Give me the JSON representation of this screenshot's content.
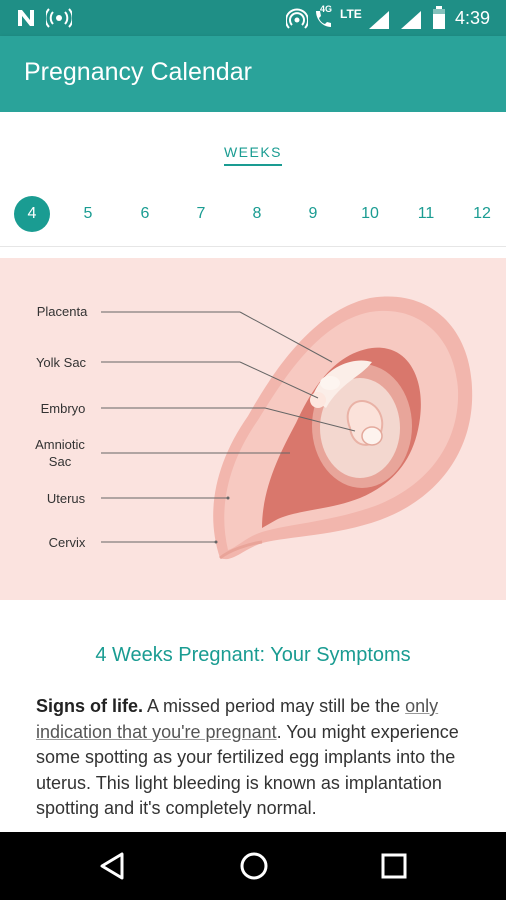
{
  "status_bar": {
    "time": "4:39",
    "network": "LTE",
    "data_type": "4G"
  },
  "app_bar": {
    "title": "Pregnancy Calendar"
  },
  "weeks_tab": {
    "label": "WEEKS"
  },
  "weeks": [
    "4",
    "5",
    "6",
    "7",
    "8",
    "9",
    "10",
    "11",
    "12"
  ],
  "selected_week": "4",
  "illustration": {
    "labels": {
      "placenta": "Placenta",
      "yolk_sac": "Yolk Sac",
      "embryo": "Embryo",
      "amniotic_1": "Amniotic",
      "amniotic_2": "Sac",
      "uterus": "Uterus",
      "cervix": "Cervix"
    }
  },
  "article": {
    "heading": "4 Weeks Pregnant: Your Symptoms",
    "lead": "Signs of life.",
    "text1": " A missed period may still be the ",
    "link": "only indication that you're pregnant",
    "text2": ". You might experience some spotting as your fertilized egg implants into the uterus. This light bleeding is known as implantation spotting and it's completely normal."
  },
  "colors": {
    "accent": "#1a9c92",
    "app_bar": "#2aa39a",
    "status_bar": "#1f8f86",
    "illustration_bg": "#fbe3df"
  }
}
